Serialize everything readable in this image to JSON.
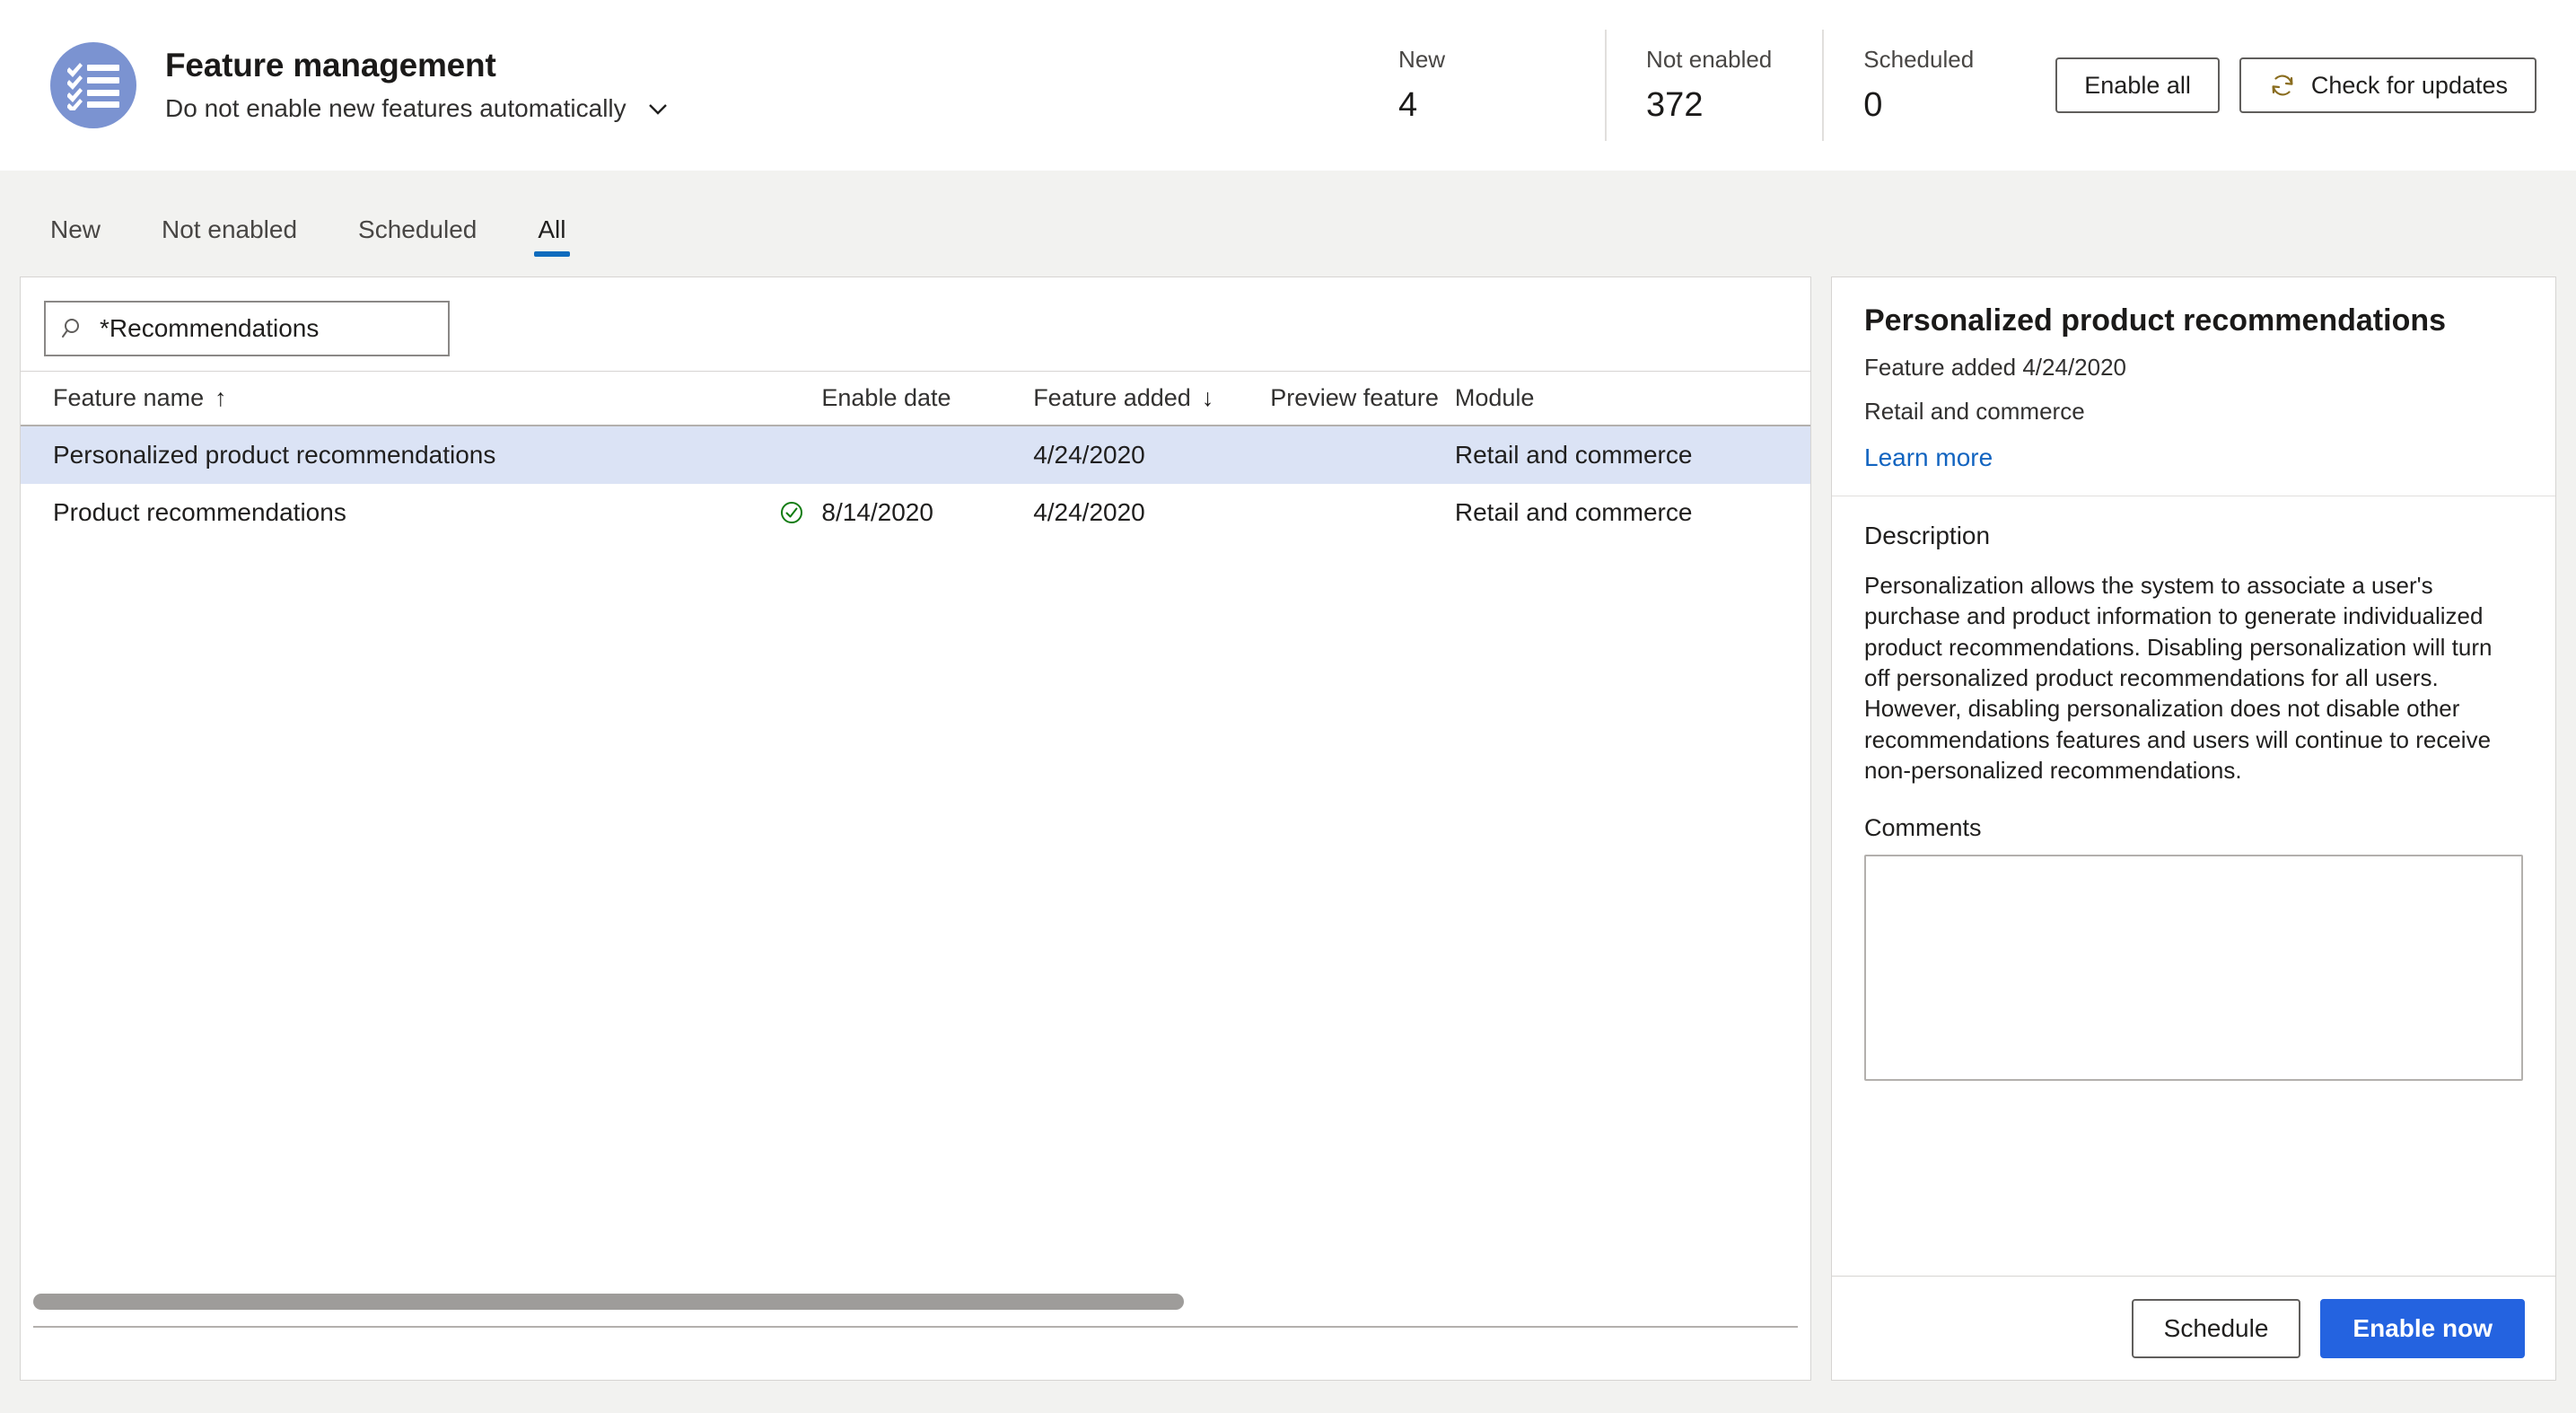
{
  "header": {
    "icon_name": "checklist-icon",
    "icon_color": "#7b93d1",
    "title": "Feature management",
    "subtitle": "Do not enable new features automatically",
    "stats": [
      {
        "label": "New",
        "value": "4"
      },
      {
        "label": "Not enabled",
        "value": "372"
      },
      {
        "label": "Scheduled",
        "value": "0"
      }
    ],
    "enable_all_label": "Enable all",
    "check_updates_label": "Check for updates",
    "check_updates_icon": "refresh-icon",
    "check_updates_icon_color": "#8a6d1f"
  },
  "tabs": [
    {
      "label": "New",
      "active": false
    },
    {
      "label": "Not enabled",
      "active": false
    },
    {
      "label": "Scheduled",
      "active": false
    },
    {
      "label": "All",
      "active": true
    }
  ],
  "accent_color": "#0f6cbd",
  "search": {
    "icon": "search-icon",
    "value": "*Recommendations",
    "placeholder": "Filter"
  },
  "grid": {
    "columns": [
      {
        "key": "name",
        "label": "Feature name",
        "sort": "↑"
      },
      {
        "key": "status",
        "label": "",
        "sort": ""
      },
      {
        "key": "enable",
        "label": "Enable date",
        "sort": ""
      },
      {
        "key": "added",
        "label": "Feature added",
        "sort": "↓"
      },
      {
        "key": "preview",
        "label": "Preview feature",
        "sort": ""
      },
      {
        "key": "module",
        "label": "Module",
        "sort": ""
      }
    ],
    "rows": [
      {
        "name": "Personalized product recommendations",
        "enabled": false,
        "enable_date": "",
        "feature_added": "4/24/2020",
        "preview_feature": "",
        "module": "Retail and commerce",
        "selected": true
      },
      {
        "name": "Product recommendations",
        "enabled": true,
        "enable_date": "8/14/2020",
        "feature_added": "4/24/2020",
        "preview_feature": "",
        "module": "Retail and commerce",
        "selected": false
      }
    ],
    "scroll_thumb_percent": 65
  },
  "detail": {
    "title": "Personalized product recommendations",
    "feature_added": "Feature added 4/24/2020",
    "module": "Retail and commerce",
    "learn_more": "Learn more",
    "description_label": "Description",
    "description": "Personalization allows the system to associate a user's purchase and product information to generate individualized product recommendations. Disabling personalization will turn off personalized product recommendations for all users. However, disabling personalization does not disable other recommendations features and users will continue to receive non-personalized recommendations.",
    "comments_label": "Comments",
    "comments_value": "",
    "schedule_label": "Schedule",
    "enable_now_label": "Enable now",
    "enable_now_color": "#2463e0"
  }
}
